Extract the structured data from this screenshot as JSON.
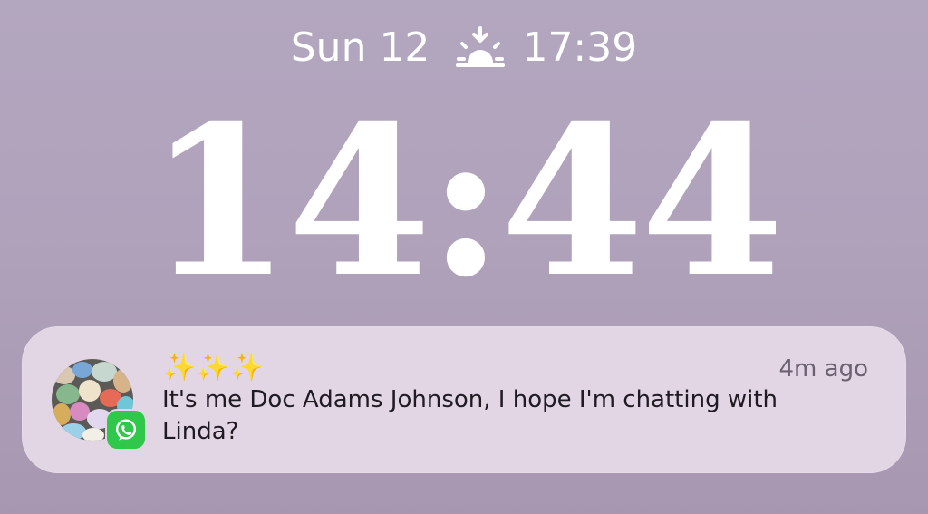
{
  "status": {
    "date": "Sun 12",
    "sun_icon": "sunset-icon",
    "sun_time": "17:39"
  },
  "clock": {
    "time": "14:44"
  },
  "notification": {
    "app_icon": "whatsapp-icon",
    "avatar": "contact-avatar",
    "title": "✨✨✨",
    "time_ago": "4m ago",
    "message": "It's me Doc Adams Johnson, I hope I'm chatting with Linda?",
    "background_color": "#e2d5e4",
    "app_color": "#2fc84b"
  }
}
